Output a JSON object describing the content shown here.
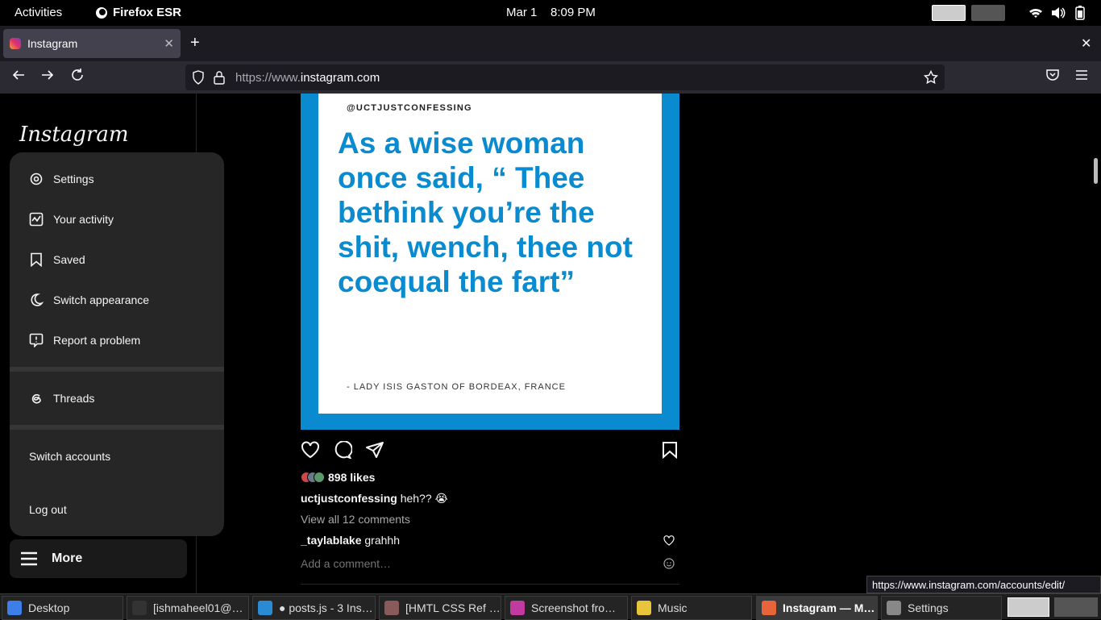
{
  "topbar": {
    "activities": "Activities",
    "app_name": "Firefox ESR",
    "date": "Mar 1",
    "time": "8:09 PM"
  },
  "browser": {
    "tab_title": "Instagram",
    "url_prefix": "https://www.",
    "url_host": "instagram.com",
    "status_url": "https://www.instagram.com/accounts/edit/"
  },
  "sidebar": {
    "logo": "Instagram",
    "menu": {
      "settings": "Settings",
      "activity": "Your activity",
      "saved": "Saved",
      "appearance": "Switch appearance",
      "report": "Report a problem",
      "threads": "Threads",
      "switch_accounts": "Switch accounts",
      "logout": "Log out"
    },
    "more": "More"
  },
  "post": {
    "image_handle": "@UCTJUSTCONFESSING",
    "image_quote": "As a wise woman once said, “ Thee bethink you’re the shit, wench, thee not coequal the fart”",
    "image_attribution": "- LADY ISIS GASTON OF BORDEAX, FRANCE",
    "likes": "898 likes",
    "author": "uctjustconfessing",
    "caption": "heh?? 😭",
    "view_all": "View all 12 comments",
    "comment_user": "_taylablake",
    "comment_text": "grahhh",
    "add_comment_placeholder": "Add a comment…"
  },
  "taskbar": [
    {
      "label": "Desktop",
      "color": "#3d7ee8"
    },
    {
      "label": "[ishmaheel01@…",
      "color": "#333"
    },
    {
      "label": "● posts.js - 3 Ins…",
      "color": "#2a8ad4"
    },
    {
      "label": "[HMTL CSS Ref …",
      "color": "#8a5a5a"
    },
    {
      "label": "Screenshot fro…",
      "color": "#c13a9e"
    },
    {
      "label": "Music",
      "color": "#e8c53a"
    },
    {
      "label": "Instagram — M…",
      "color": "#e8643a"
    },
    {
      "label": "Settings",
      "color": "#888"
    }
  ]
}
